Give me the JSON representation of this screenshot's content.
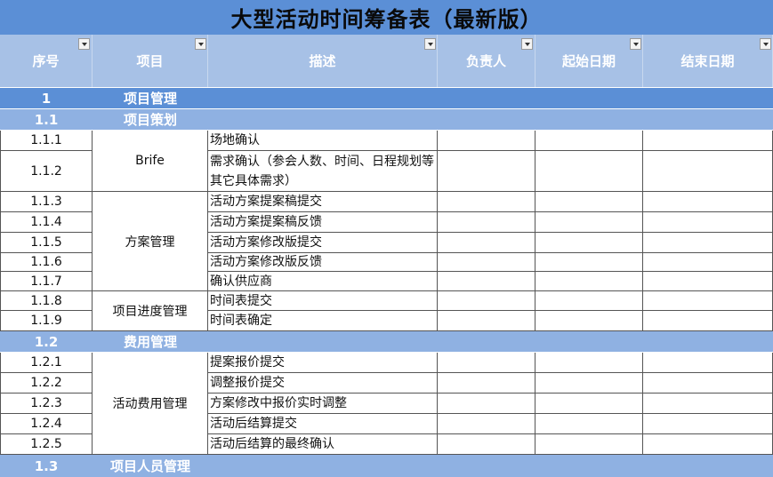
{
  "title": "大型活动时间筹备表（最新版）",
  "headers": [
    "序号",
    "项目",
    "描述",
    "负责人",
    "起始日期",
    "结束日期"
  ],
  "section": {
    "num": "1",
    "name": "项目管理"
  },
  "subsections": [
    {
      "num": "1.1",
      "name": "项目策划"
    },
    {
      "num": "1.2",
      "name": "费用管理"
    },
    {
      "num": "1.3",
      "name": "项目人员管理"
    }
  ],
  "groups": [
    "Brife",
    "方案管理",
    "项目进度管理",
    "活动费用管理"
  ],
  "rows": [
    {
      "num": "1.1.1",
      "desc": "场地确认"
    },
    {
      "num": "1.1.2",
      "desc": "需求确认（参会人数、时间、日程规划等其它具体需求）"
    },
    {
      "num": "1.1.3",
      "desc": "活动方案提案稿提交"
    },
    {
      "num": "1.1.4",
      "desc": "活动方案提案稿反馈"
    },
    {
      "num": "1.1.5",
      "desc": "活动方案修改版提交"
    },
    {
      "num": "1.1.6",
      "desc": "活动方案修改版反馈"
    },
    {
      "num": "1.1.7",
      "desc": "确认供应商"
    },
    {
      "num": "1.1.8",
      "desc": "时间表提交"
    },
    {
      "num": "1.1.9",
      "desc": "时间表确定"
    },
    {
      "num": "1.2.1",
      "desc": "提案报价提交"
    },
    {
      "num": "1.2.2",
      "desc": "调整报价提交"
    },
    {
      "num": "1.2.3",
      "desc": "方案修改中报价实时调整"
    },
    {
      "num": "1.2.4",
      "desc": "活动后结算提交"
    },
    {
      "num": "1.2.5",
      "desc": "活动后结算的最终确认"
    }
  ]
}
